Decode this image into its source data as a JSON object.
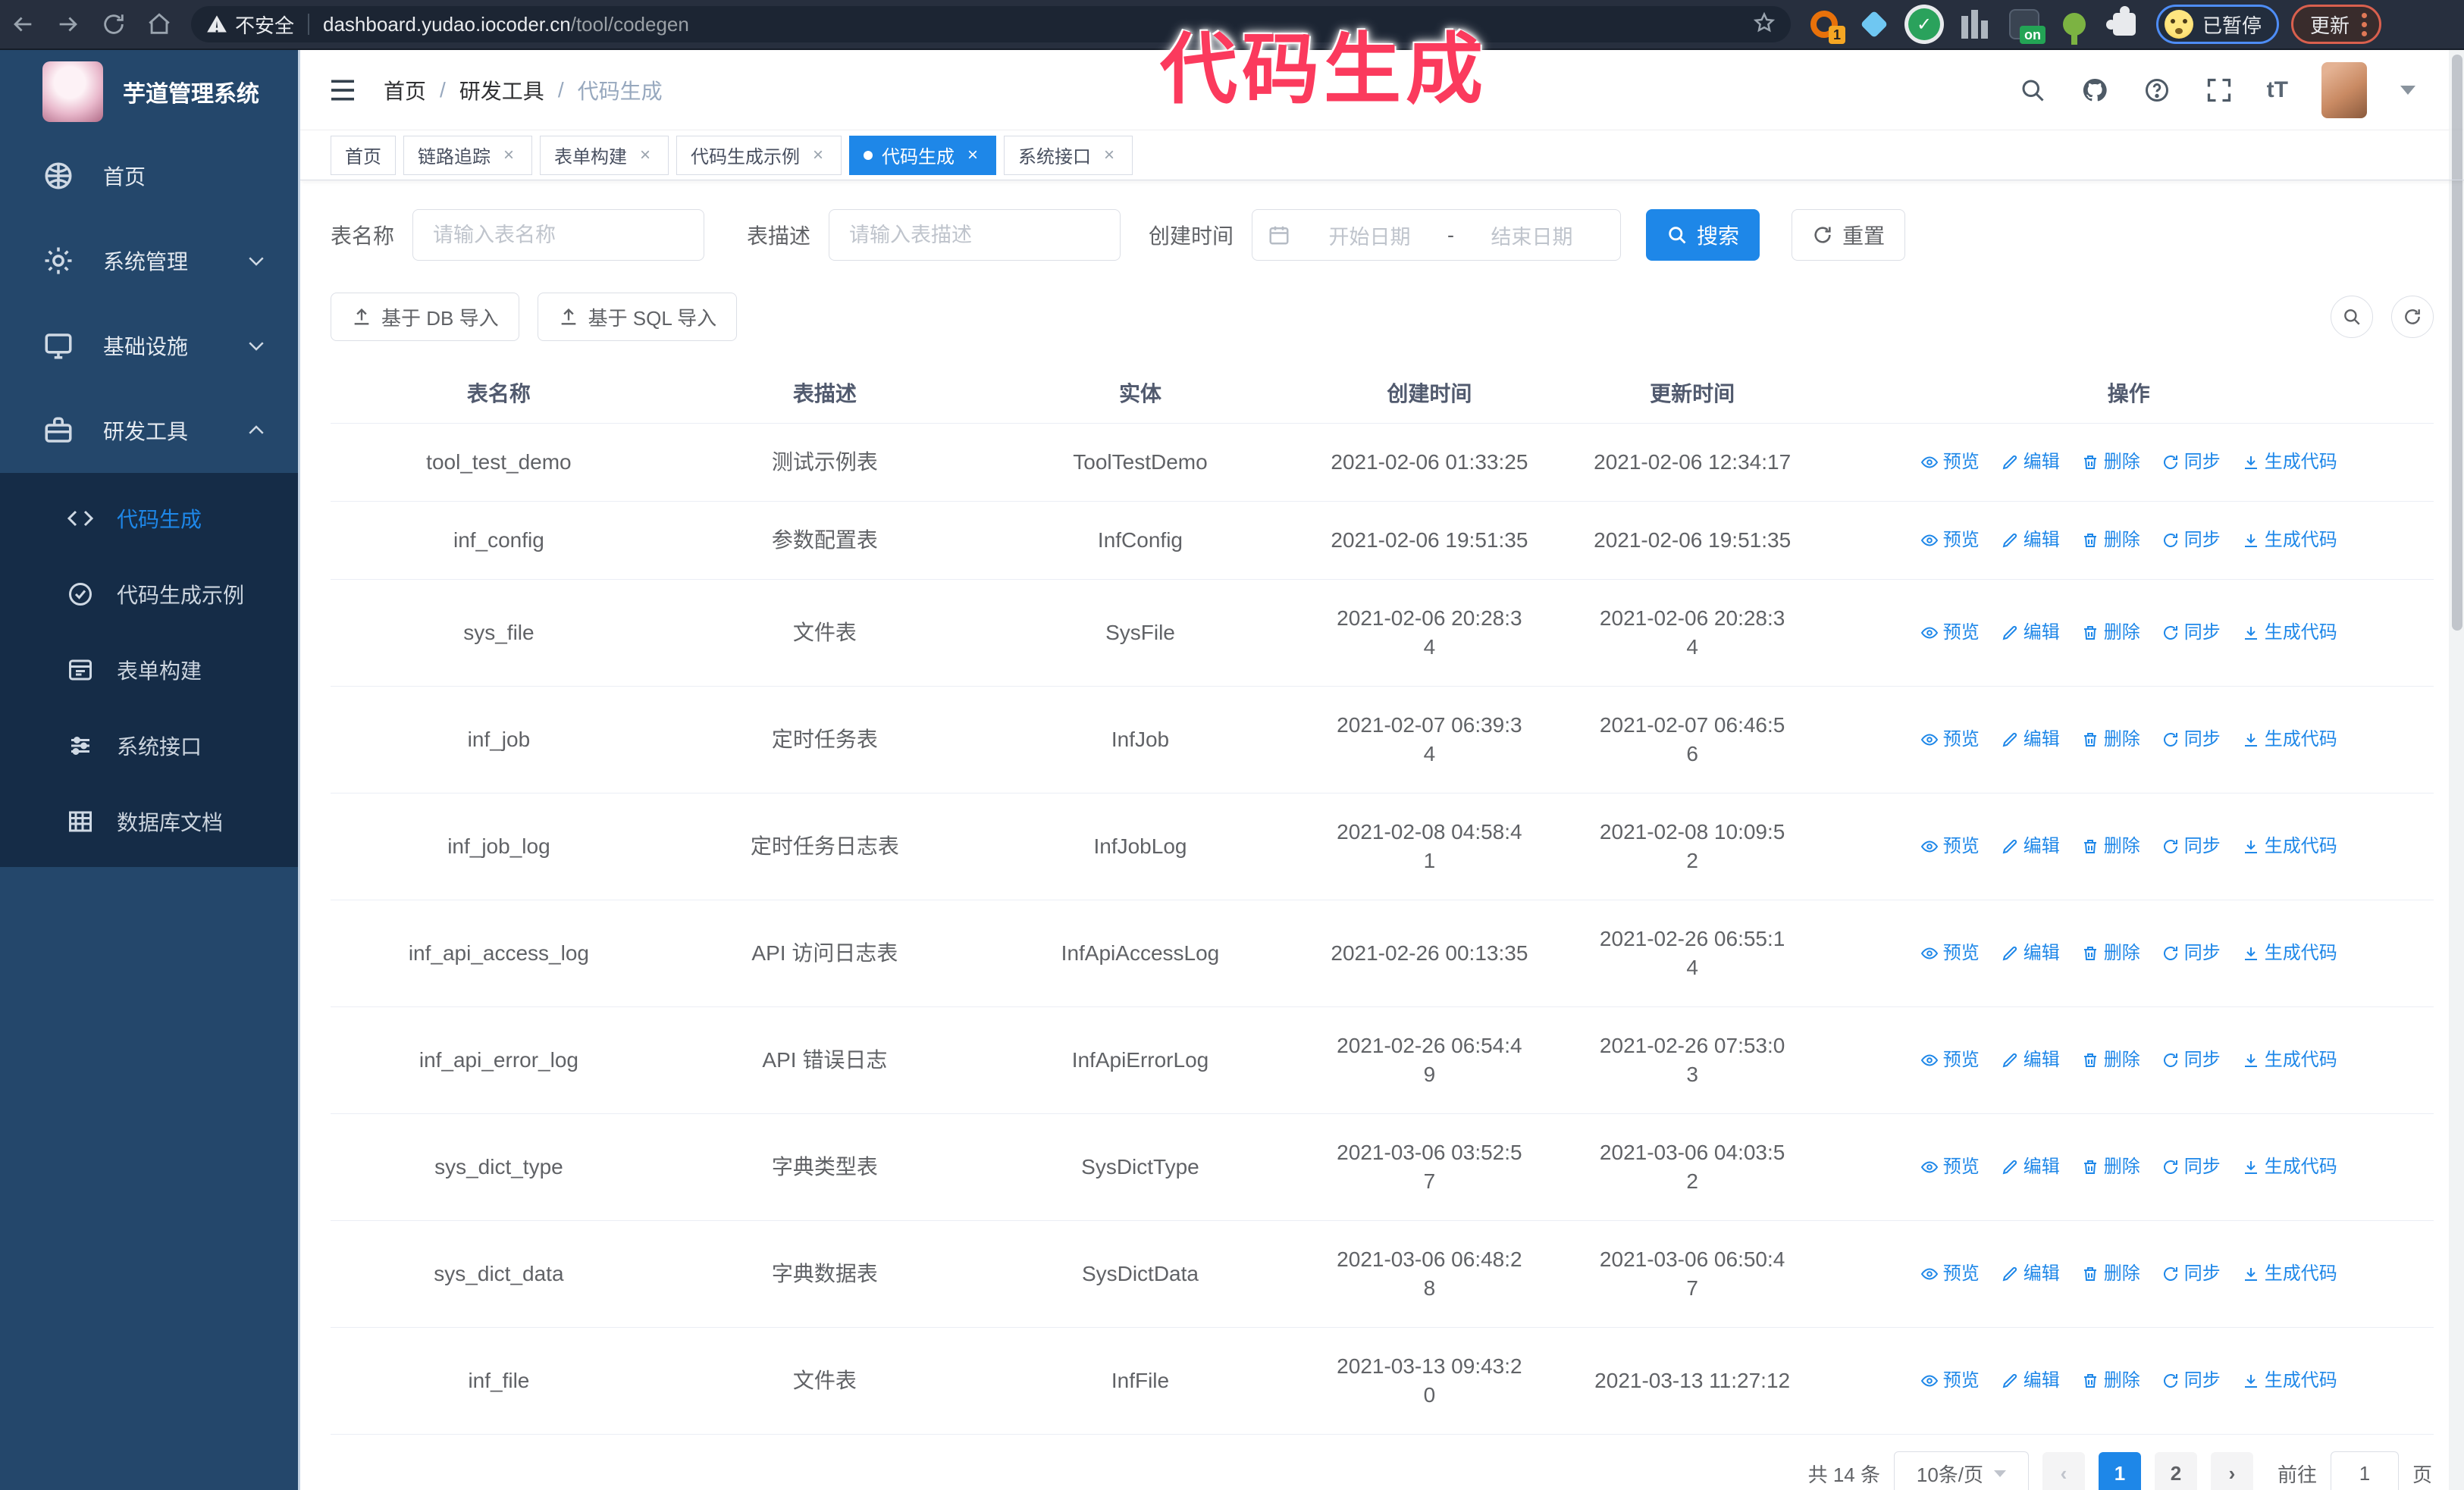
{
  "colors": {
    "accent": "#1e87e8",
    "annotation_pink": "#fb3a5d",
    "sidebar_bg": "#24476b",
    "submenu_bg": "#152c47"
  },
  "annotation": {
    "text": "代码生成"
  },
  "browser": {
    "security_label": "不安全",
    "url_host": "dashboard.yudao.iocoder.cn",
    "url_path": "/tool/codegen",
    "extension_badge": "1",
    "extension_on_badge": "on",
    "profile_label": "已暂停",
    "update_label": "更新"
  },
  "sidebar": {
    "logo_title": "芋道管理系统",
    "menu": [
      {
        "label": "首页",
        "icon": "dashboard",
        "chevron": ""
      },
      {
        "label": "系统管理",
        "icon": "gear",
        "chevron": "down"
      },
      {
        "label": "基础设施",
        "icon": "monitor",
        "chevron": "down"
      },
      {
        "label": "研发工具",
        "icon": "toolbox",
        "chevron": "up"
      }
    ],
    "submenu": [
      {
        "label": "代码生成",
        "icon": "code",
        "active": true
      },
      {
        "label": "代码生成示例",
        "icon": "badge-check",
        "active": false
      },
      {
        "label": "表单构建",
        "icon": "form",
        "active": false
      },
      {
        "label": "系统接口",
        "icon": "sliders",
        "active": false
      },
      {
        "label": "数据库文档",
        "icon": "db-doc",
        "active": false
      }
    ]
  },
  "header": {
    "breadcrumb": [
      "首页",
      "研发工具",
      "代码生成"
    ],
    "separator": "/"
  },
  "tabs": [
    {
      "label": "首页",
      "closable": false,
      "active": false
    },
    {
      "label": "链路追踪",
      "closable": true,
      "active": false
    },
    {
      "label": "表单构建",
      "closable": true,
      "active": false
    },
    {
      "label": "代码生成示例",
      "closable": true,
      "active": false
    },
    {
      "label": "代码生成",
      "closable": true,
      "active": true
    },
    {
      "label": "系统接口",
      "closable": true,
      "active": false
    }
  ],
  "filters": {
    "table_name_label": "表名称",
    "table_name_placeholder": "请输入表名称",
    "table_desc_label": "表描述",
    "table_desc_placeholder": "请输入表描述",
    "create_time_label": "创建时间",
    "date_start_placeholder": "开始日期",
    "date_separator": "-",
    "date_end_placeholder": "结束日期",
    "search_label": "搜索",
    "reset_label": "重置"
  },
  "toolbar": {
    "db_import_label": "基于 DB 导入",
    "sql_import_label": "基于 SQL 导入"
  },
  "table": {
    "columns": [
      "表名称",
      "表描述",
      "实体",
      "创建时间",
      "更新时间",
      "操作"
    ],
    "actions": [
      "预览",
      "编辑",
      "删除",
      "同步",
      "生成代码"
    ],
    "action_icons": [
      "eye",
      "edit",
      "trash",
      "sync",
      "download"
    ],
    "rows": [
      {
        "name": "tool_test_demo",
        "desc": "测试示例表",
        "entity": "ToolTestDemo",
        "created": "2021-02-06 01:33:25",
        "updated": "2021-02-06 12:34:17"
      },
      {
        "name": "inf_config",
        "desc": "参数配置表",
        "entity": "InfConfig",
        "created": "2021-02-06 19:51:35",
        "updated": "2021-02-06 19:51:35"
      },
      {
        "name": "sys_file",
        "desc": "文件表",
        "entity": "SysFile",
        "created": "2021-02-06 20:28:3\n4",
        "updated": "2021-02-06 20:28:3\n4"
      },
      {
        "name": "inf_job",
        "desc": "定时任务表",
        "entity": "InfJob",
        "created": "2021-02-07 06:39:3\n4",
        "updated": "2021-02-07 06:46:5\n6"
      },
      {
        "name": "inf_job_log",
        "desc": "定时任务日志表",
        "entity": "InfJobLog",
        "created": "2021-02-08 04:58:4\n1",
        "updated": "2021-02-08 10:09:5\n2"
      },
      {
        "name": "inf_api_access_log",
        "desc": "API 访问日志表",
        "entity": "InfApiAccessLog",
        "created": "2021-02-26 00:13:35",
        "updated": "2021-02-26 06:55:1\n4"
      },
      {
        "name": "inf_api_error_log",
        "desc": "API 错误日志",
        "entity": "InfApiErrorLog",
        "created": "2021-02-26 06:54:4\n9",
        "updated": "2021-02-26 07:53:0\n3"
      },
      {
        "name": "sys_dict_type",
        "desc": "字典类型表",
        "entity": "SysDictType",
        "created": "2021-03-06 03:52:5\n7",
        "updated": "2021-03-06 04:03:5\n2"
      },
      {
        "name": "sys_dict_data",
        "desc": "字典数据表",
        "entity": "SysDictData",
        "created": "2021-03-06 06:48:2\n8",
        "updated": "2021-03-06 06:50:4\n7"
      },
      {
        "name": "inf_file",
        "desc": "文件表",
        "entity": "InfFile",
        "created": "2021-03-13 09:43:2\n0",
        "updated": "2021-03-13 11:27:12"
      }
    ]
  },
  "pagination": {
    "total": "共 14 条",
    "page_size": "10条/页",
    "pages": [
      "1",
      "2"
    ],
    "active_page": "1",
    "goto_label": "前往",
    "goto_value": "1",
    "page_suffix": "页"
  }
}
